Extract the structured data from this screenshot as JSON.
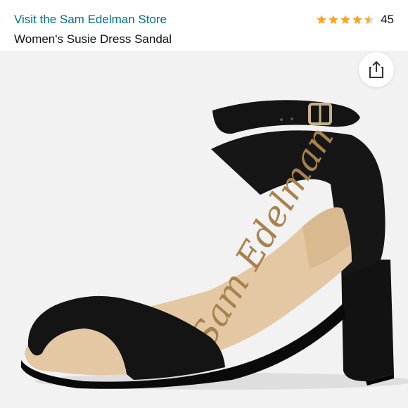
{
  "header": {
    "store_link": "Visit the Sam Edelman Store",
    "product_title": "Women's Susie Dress Sandal",
    "rating": {
      "stars": 4.5,
      "max_stars": 5,
      "count": "45",
      "star_color": "#ffa41c",
      "empty_star_color": "#d5d9d9"
    }
  },
  "product_image": {
    "insole_brand_text": "Sam Edelman",
    "background_color": "#f2f2f2"
  },
  "share_button": {
    "icon": "share-icon"
  }
}
